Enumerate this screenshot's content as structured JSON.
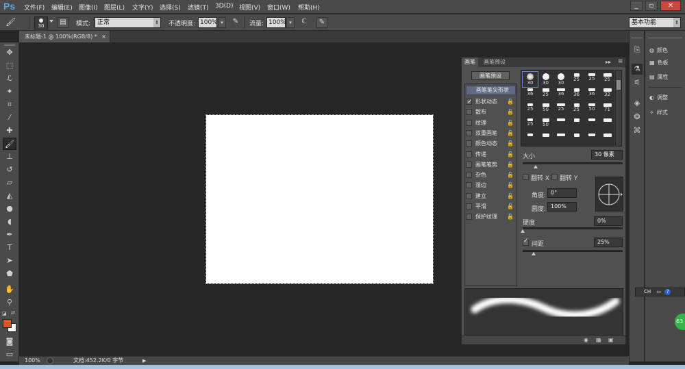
{
  "app": {
    "logo": "Ps"
  },
  "menubar": {
    "items": [
      "文件(F)",
      "编辑(E)",
      "图像(I)",
      "图层(L)",
      "文字(Y)",
      "选择(S)",
      "滤镜(T)",
      "3D(D)",
      "视图(V)",
      "窗口(W)",
      "帮助(H)"
    ],
    "win_minimize": "_",
    "win_restore": "▫",
    "win_close": "✕"
  },
  "options": {
    "brush_size": "30",
    "mode_label": "模式:",
    "mode_value": "正常",
    "opacity_label": "不透明度:",
    "opacity_value": "100%",
    "flow_label": "流量:",
    "flow_value": "100%",
    "workspace": "基本功能"
  },
  "doc_tab": {
    "title": "未标题-1 @ 100%(RGB/8) *",
    "close": "×"
  },
  "status": {
    "zoom": "100%",
    "doc_info": "文档:452.2K/0 字节"
  },
  "right_panel": {
    "items": [
      "颜色",
      "色板",
      "属性",
      "调整",
      "样式"
    ]
  },
  "brush_panel": {
    "tab_brush": "画笔",
    "tab_presets": "画笔预设",
    "preset_button": "画笔预设",
    "tip_shape": "画笔笔尖形状",
    "options": [
      {
        "label": "形状动态",
        "checked": true
      },
      {
        "label": "散布",
        "checked": false
      },
      {
        "label": "纹理",
        "checked": false
      },
      {
        "label": "双重画笔",
        "checked": false
      },
      {
        "label": "颜色动态",
        "checked": false
      },
      {
        "label": "传递",
        "checked": false
      },
      {
        "label": "画笔笔势",
        "checked": false
      },
      {
        "label": "杂色",
        "checked": false
      },
      {
        "label": "湿边",
        "checked": false
      },
      {
        "label": "建立",
        "checked": false
      },
      {
        "label": "平滑",
        "checked": false
      },
      {
        "label": "保护纹理",
        "checked": false
      }
    ],
    "tip_sizes": [
      "30",
      "30",
      "30",
      "25",
      "25",
      "25",
      "36",
      "25",
      "36",
      "36",
      "36",
      "32",
      "25",
      "50",
      "25",
      "25",
      "50",
      "71",
      "25",
      "50"
    ],
    "size_label": "大小",
    "size_value": "30 像素",
    "flip_x": "翻转 X",
    "flip_y": "翻转 Y",
    "angle_label": "角度:",
    "angle_value": "0°",
    "roundness_label": "圆度:",
    "roundness_value": "100%",
    "hardness_label": "硬度",
    "hardness_value": "0%",
    "spacing_label": "间距",
    "spacing_value": "25%"
  },
  "overlay": {
    "ch_label": "CH",
    "badge": "63"
  }
}
